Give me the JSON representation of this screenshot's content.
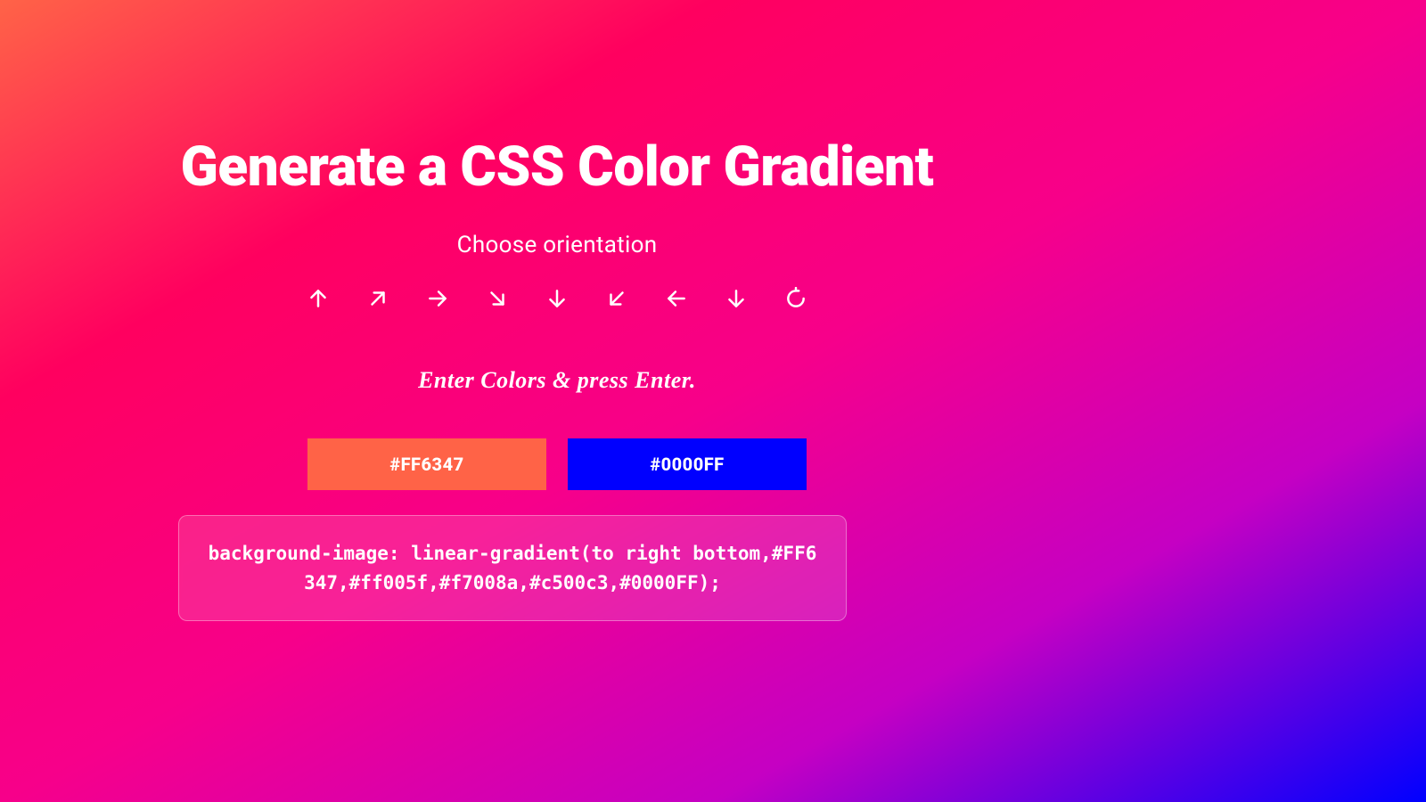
{
  "title": "Generate a CSS Color Gradient",
  "subtitle": "Choose orientation",
  "orientation": {
    "buttons": [
      {
        "name": "arrow-up-icon"
      },
      {
        "name": "arrow-up-right-icon"
      },
      {
        "name": "arrow-right-icon"
      },
      {
        "name": "arrow-down-right-icon"
      },
      {
        "name": "arrow-down-icon"
      },
      {
        "name": "arrow-down-left-icon"
      },
      {
        "name": "arrow-left-icon"
      },
      {
        "name": "arrow-down-icon"
      },
      {
        "name": "rotate-icon"
      }
    ]
  },
  "enter_colors_label": "Enter Colors & press Enter.",
  "colors": {
    "first": "#FF6347",
    "second": "#0000FF"
  },
  "css_output": "background-image: linear-gradient(to right bottom,#FF6347,#ff005f,#f7008a,#c500c3,#0000FF);"
}
